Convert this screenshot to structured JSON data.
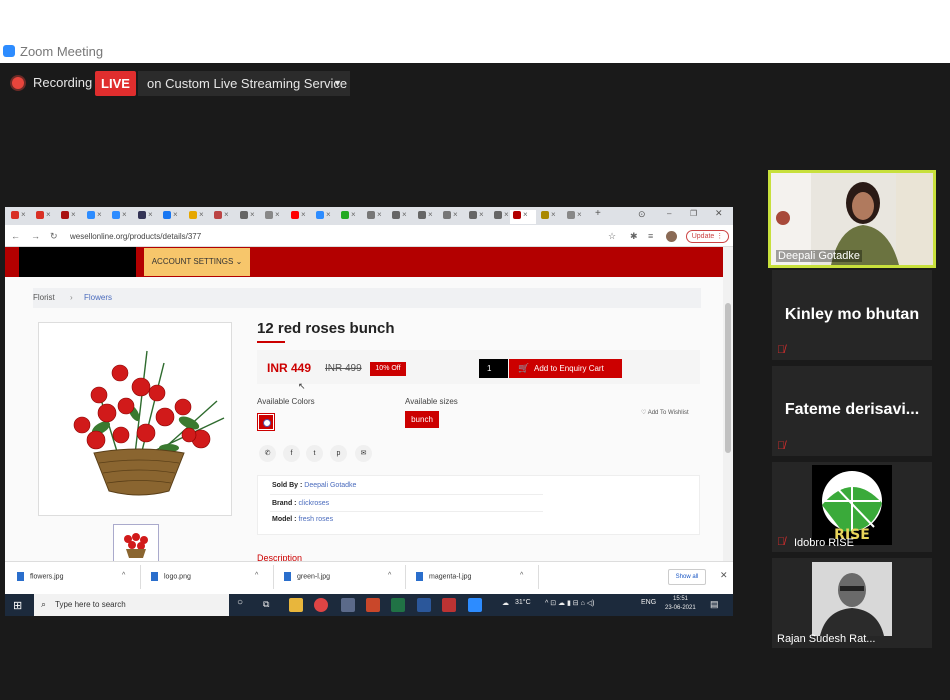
{
  "window": {
    "title": "Zoom Meeting"
  },
  "recording": {
    "label": "Recording",
    "live_badge": "LIVE",
    "stream_service": "on Custom Live Streaming Service"
  },
  "browser": {
    "url": "wesellonline.org/products/details/377",
    "update_label": "Update",
    "tab_x": "×"
  },
  "site": {
    "account_settings": "ACCOUNT SETTINGS ⌄",
    "breadcrumb": {
      "root": "Florist",
      "sep": "›",
      "current": "Flowers"
    },
    "product": {
      "title": "12 red roses bunch",
      "price": "INR 449",
      "old_price": "INR 499",
      "discount": "10% Off",
      "qty": "1",
      "add_to_cart": "Add to Enquiry Cart",
      "available_colors_label": "Available Colors",
      "available_sizes_label": "Available sizes",
      "size": "bunch",
      "wishlist": "♡ Add To Wishlist",
      "sold_by_label": "Sold By :",
      "sold_by": "Deepali Gotadke",
      "brand_label": "Brand :",
      "brand": "clickroses",
      "model_label": "Model :",
      "model": "fresh roses",
      "description_label": "Description"
    }
  },
  "downloads": {
    "files": [
      "flowers.jpg",
      "logo.png",
      "green-l.jpg",
      "magenta-l.jpg"
    ],
    "show_all": "Show all"
  },
  "taskbar": {
    "search_placeholder": "Type here to search",
    "weather": "31°C",
    "lang": "ENG",
    "time": "15:51",
    "date": "23-06-2021"
  },
  "participants": [
    {
      "name": "Deepali Gotadke"
    },
    {
      "name": "Kinley mo bhutan"
    },
    {
      "name": "Fateme  derisavi..."
    },
    {
      "name": "Idobro RISE",
      "logo_text": "RISE"
    },
    {
      "name": "Rajan Sudesh Rat..."
    }
  ],
  "colors": {
    "accent_red": "#b30000",
    "live_red": "#e02e2e",
    "highlight": "#c8e03c"
  }
}
